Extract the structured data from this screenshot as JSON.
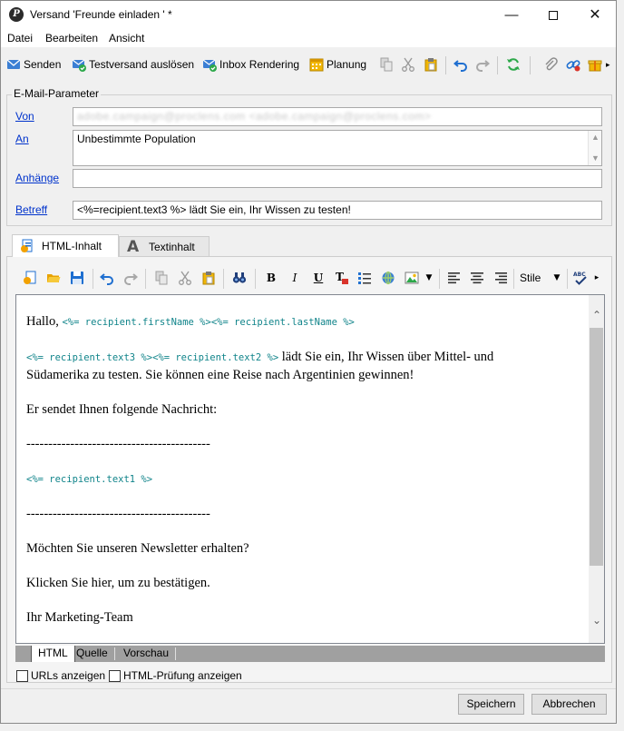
{
  "window": {
    "title": "Versand 'Freunde einladen ' *"
  },
  "menu": [
    "Datei",
    "Bearbeiten",
    "Ansicht"
  ],
  "toolbar": {
    "send": "Senden",
    "proof": "Testversand auslösen",
    "inbox": "Inbox Rendering",
    "schedule": "Planung"
  },
  "params": {
    "group_title": "E-Mail-Parameter",
    "from_label": "Von",
    "from_value": "adobe.campaign@proclens.com <adobe.campaign@proclens.com>",
    "to_label": "An",
    "to_value": "Unbestimmte Population",
    "attachments_label": "Anhänge",
    "attachments_value": "",
    "subject_label": "Betreff",
    "subject_value": "<%=recipient.text3 %> lädt Sie ein, Ihr Wissen zu testen!"
  },
  "tabs": {
    "html": "HTML-Inhalt",
    "text": "Textinhalt"
  },
  "editor_toolbar": {
    "bold": "B",
    "italic": "I",
    "underline": "U",
    "style": "Stile"
  },
  "content": {
    "greeting": "Hallo,",
    "greeting_code": "<%= recipient.firstName %><%= recipient.lastName %>",
    "intro_code": "<%= recipient.text3 %><%= recipient.text2 %>",
    "intro_text_1": " lädt Sie ein, Ihr Wissen über Mittel- und",
    "intro_text_2": "Südamerika zu testen. Sie können eine Reise nach Argentinien gewinnen!",
    "message_intro": "Er sendet Ihnen folgende Nachricht:",
    "separator": "------------------------------------------",
    "message_code": "<%= recipient.text1 %>",
    "newsletter": "Möchten Sie unseren Newsletter erhalten?",
    "confirm": "Klicken Sie hier, um zu bestätigen.",
    "signature": "Ihr Marketing-Team"
  },
  "view_tabs": [
    "HTML",
    "Quelle",
    "Vorschau"
  ],
  "options": {
    "show_urls": "URLs anzeigen",
    "html_check": "HTML-Prüfung anzeigen"
  },
  "buttons": {
    "save": "Speichern",
    "cancel": "Abbrechen"
  },
  "colors": {
    "code": "#10848a",
    "link": "#0033cc",
    "accent_blue": "#1f6fd0",
    "accent_green": "#28a745"
  }
}
